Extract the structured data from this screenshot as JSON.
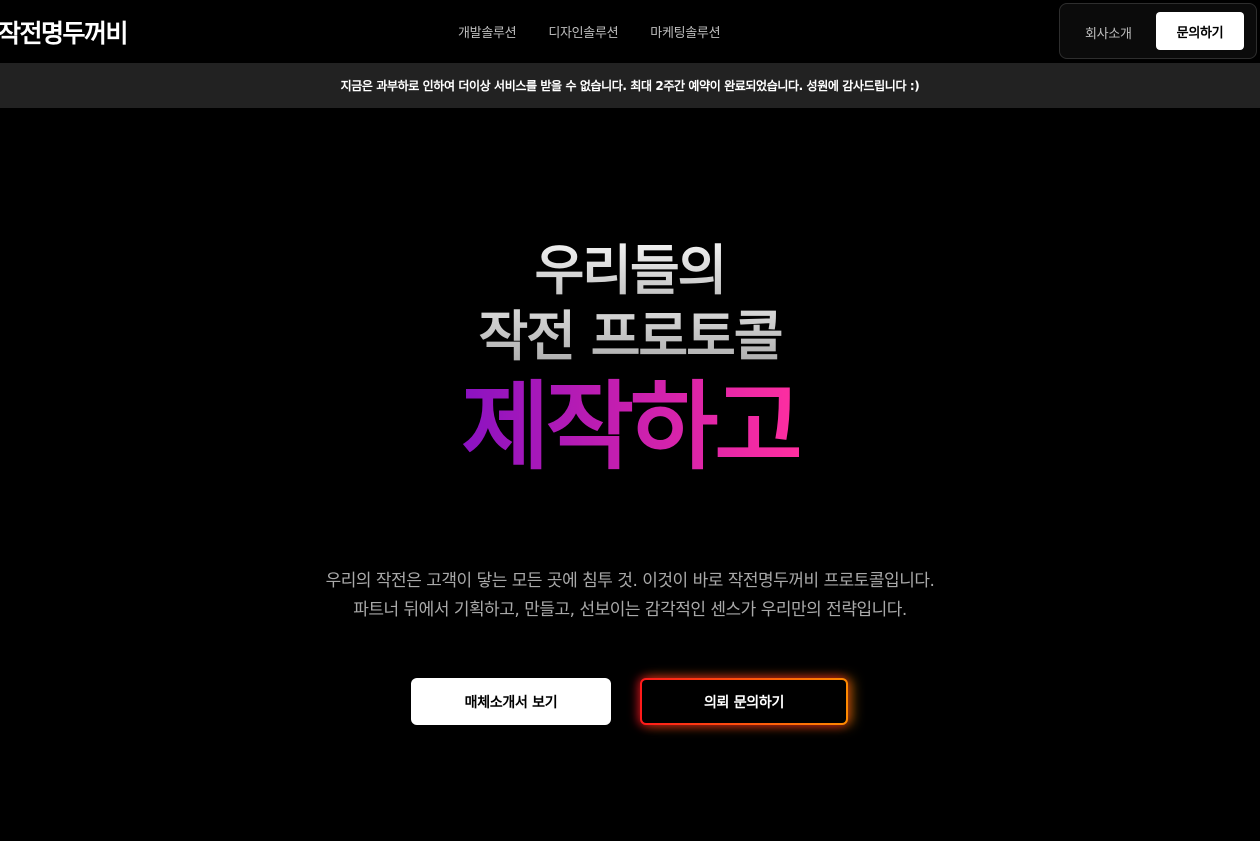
{
  "header": {
    "logo": "작전명두꺼비",
    "nav": [
      {
        "label": "개발솔루션"
      },
      {
        "label": "디자인솔루션"
      },
      {
        "label": "마케팅솔루션"
      }
    ],
    "about_label": "회사소개",
    "contact_label": "문의하기"
  },
  "notice": {
    "text": "지금은 과부하로 인하여 더이상 서비스를 받을 수 없습니다. 최대 2주간 예약이 완료되었습니다. 성원에 감사드립니다 :)"
  },
  "hero": {
    "line1": "우리들의",
    "line2": "작전 프로토콜",
    "line3": "제작하고",
    "desc_line1": "우리의 작전은 고객이 닿는 모든 곳에 침투 것. 이것이 바로 작전명두꺼비 프로토콜입니다.",
    "desc_line2": "파트너 뒤에서 기획하고, 만들고, 선보이는 감각적인 센스가 우리만의 전략입니다.",
    "primary_button": "매체소개서 보기",
    "secondary_button": "의뢰 문의하기"
  },
  "colors": {
    "background": "#000000",
    "notice_bar": "#222222",
    "gradient_start": "#8a12c2",
    "gradient_end": "#ff2ea0",
    "glow_red": "#ff1a1a",
    "glow_orange": "#ff8a00"
  }
}
